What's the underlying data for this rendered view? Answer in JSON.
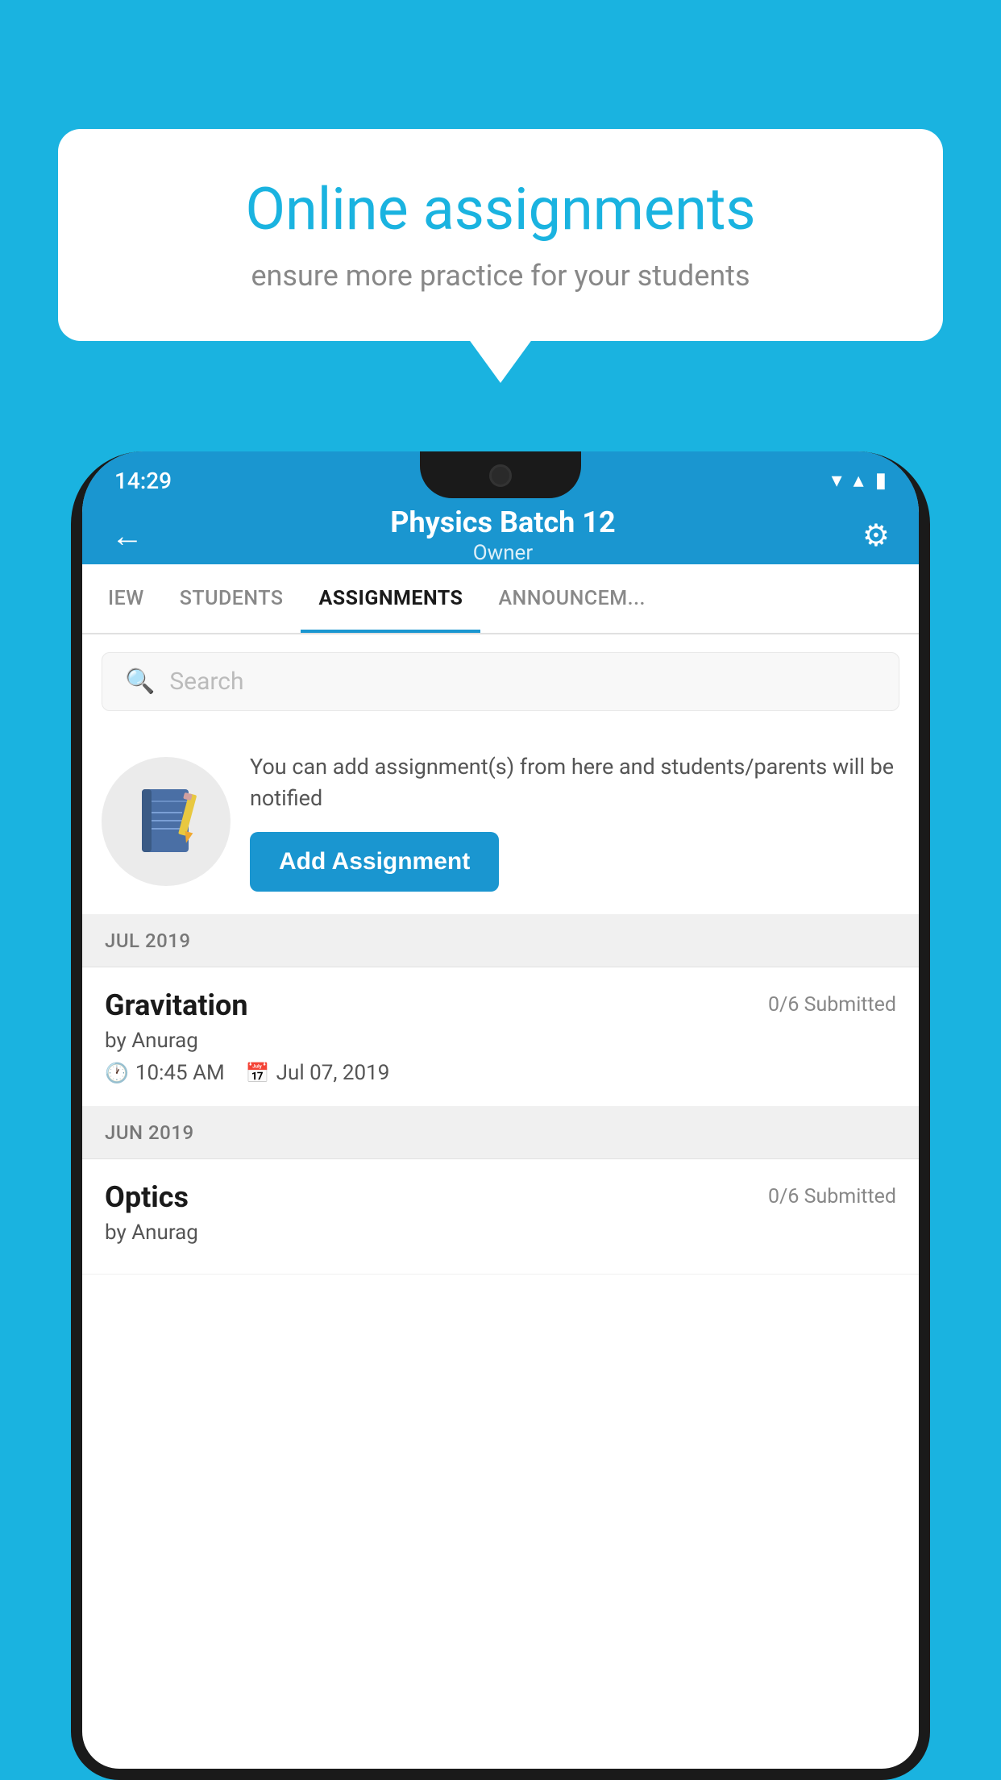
{
  "background_color": "#1ab3e0",
  "speech_bubble": {
    "title": "Online assignments",
    "subtitle": "ensure more practice for your students"
  },
  "status_bar": {
    "time": "14:29",
    "wifi_icon": "▼",
    "signal_icon": "▲",
    "battery_icon": "▮"
  },
  "header": {
    "title": "Physics Batch 12",
    "subtitle": "Owner",
    "back_label": "←",
    "settings_label": "⚙"
  },
  "tabs": [
    {
      "label": "IEW",
      "active": false
    },
    {
      "label": "STUDENTS",
      "active": false
    },
    {
      "label": "ASSIGNMENTS",
      "active": true
    },
    {
      "label": "ANNOUNCEM...",
      "active": false
    }
  ],
  "search": {
    "placeholder": "Search"
  },
  "info_card": {
    "description": "You can add assignment(s) from here and students/parents will be notified",
    "button_label": "Add Assignment"
  },
  "assignments": [
    {
      "month_label": "JUL 2019",
      "title": "Gravitation",
      "submitted": "0/6 Submitted",
      "author": "by Anurag",
      "time": "10:45 AM",
      "date": "Jul 07, 2019"
    },
    {
      "month_label": "JUN 2019",
      "title": "Optics",
      "submitted": "0/6 Submitted",
      "author": "by Anurag",
      "time": "",
      "date": ""
    }
  ]
}
